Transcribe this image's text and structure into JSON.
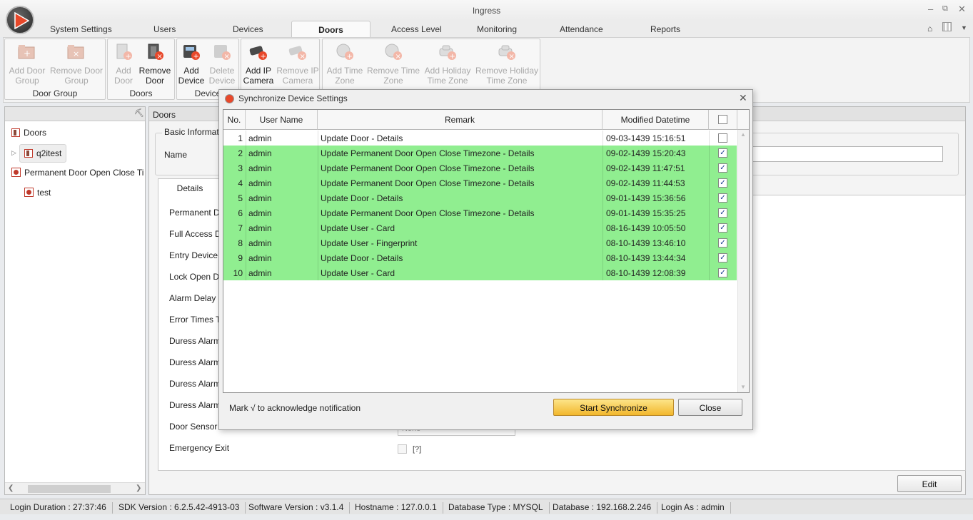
{
  "app": {
    "title": "Ingress"
  },
  "tabs": [
    {
      "label": "System Settings"
    },
    {
      "label": "Users"
    },
    {
      "label": "Devices"
    },
    {
      "label": "Doors"
    },
    {
      "label": "Access Level"
    },
    {
      "label": "Monitoring"
    },
    {
      "label": "Attendance"
    },
    {
      "label": "Reports"
    }
  ],
  "ribbon": {
    "groups": [
      {
        "label": "Door Group"
      },
      {
        "label": "Doors"
      },
      {
        "label": "Device"
      }
    ],
    "buttons": {
      "add_door_group": [
        "Add Door",
        "Group"
      ],
      "remove_door_group": [
        "Remove Door",
        "Group"
      ],
      "add_door": [
        "Add",
        "Door"
      ],
      "remove_door": [
        "Remove",
        "Door"
      ],
      "add_device": [
        "Add",
        "Device"
      ],
      "delete_device": [
        "Delete",
        "Device"
      ],
      "add_ip_camera": [
        "Add IP",
        "Camera"
      ],
      "remove_ip_camera": [
        "Remove IP",
        "Camera"
      ],
      "add_time_zone": [
        "Add Time",
        "Zone"
      ],
      "remove_time_zone": [
        "Remove Time",
        "Zone"
      ],
      "add_holiday_tz": [
        "Add Holiday",
        "Time Zone"
      ],
      "remove_holiday_tz": [
        "Remove Holiday",
        "Time Zone"
      ]
    }
  },
  "tree": {
    "root": "Doors",
    "group": "q2itest",
    "permanent": "Permanent Door Open Close Ti",
    "child": "test"
  },
  "main": {
    "header": "Doors",
    "basic_info": "Basic Informat",
    "name_label": "Name",
    "details_tab": "Details",
    "labels": [
      "Permanent D",
      "Full Access D",
      "Entry Device",
      "Lock Open D",
      "Alarm Delay",
      "Error Times T",
      "Duress Alarm",
      "Duress Alarm",
      "Duress Alarm",
      "Duress Alarm",
      "Door Sensor",
      "Emergency Exit"
    ],
    "door_sensor_value": "None",
    "emergency_help": "[?]",
    "edit_button": "Edit"
  },
  "dialog": {
    "title": "Synchronize Device Settings",
    "columns": {
      "no": "No.",
      "user": "User Name",
      "remark": "Remark",
      "datetime": "Modified Datetime"
    },
    "rows": [
      {
        "no": "1",
        "user": "admin",
        "remark": "Update Door - Details",
        "datetime": "09-03-1439 15:16:51",
        "checked": false
      },
      {
        "no": "2",
        "user": "admin",
        "remark": "Update Permanent Door Open Close Timezone - Details",
        "datetime": "09-02-1439 15:20:43",
        "checked": true
      },
      {
        "no": "3",
        "user": "admin",
        "remark": "Update Permanent Door Open Close Timezone - Details",
        "datetime": "09-02-1439 11:47:51",
        "checked": true
      },
      {
        "no": "4",
        "user": "admin",
        "remark": "Update Permanent Door Open Close Timezone - Details",
        "datetime": "09-02-1439 11:44:53",
        "checked": true
      },
      {
        "no": "5",
        "user": "admin",
        "remark": "Update Door - Details",
        "datetime": "09-01-1439 15:36:56",
        "checked": true
      },
      {
        "no": "6",
        "user": "admin",
        "remark": "Update Permanent Door Open Close Timezone - Details",
        "datetime": "09-01-1439 15:35:25",
        "checked": true
      },
      {
        "no": "7",
        "user": "admin",
        "remark": "Update User - Card",
        "datetime": "08-16-1439 10:05:50",
        "checked": true
      },
      {
        "no": "8",
        "user": "admin",
        "remark": "Update User - Fingerprint",
        "datetime": "08-10-1439 13:46:10",
        "checked": true
      },
      {
        "no": "9",
        "user": "admin",
        "remark": "Update Door - Details",
        "datetime": "08-10-1439 13:44:34",
        "checked": true
      },
      {
        "no": "10",
        "user": "admin",
        "remark": "Update User - Card",
        "datetime": "08-10-1439 12:08:39",
        "checked": true
      }
    ],
    "hint": "Mark √ to acknowledge notification",
    "start_button": "Start Synchronize",
    "close_button": "Close",
    "highlight_color": "#90ee90"
  },
  "status": {
    "login_duration": "Login Duration : 27:37:46",
    "sdk": "SDK Version : 6.2.5.42-4913-03",
    "software": "Software Version : v3.1.4",
    "hostname": "Hostname : 127.0.0.1",
    "db_type": "Database Type : MYSQL",
    "database": "Database : 192.168.2.246",
    "login_as": "Login As : admin"
  },
  "colors": {
    "accent": "#e8482a",
    "primary_button": "#f7c94a"
  }
}
